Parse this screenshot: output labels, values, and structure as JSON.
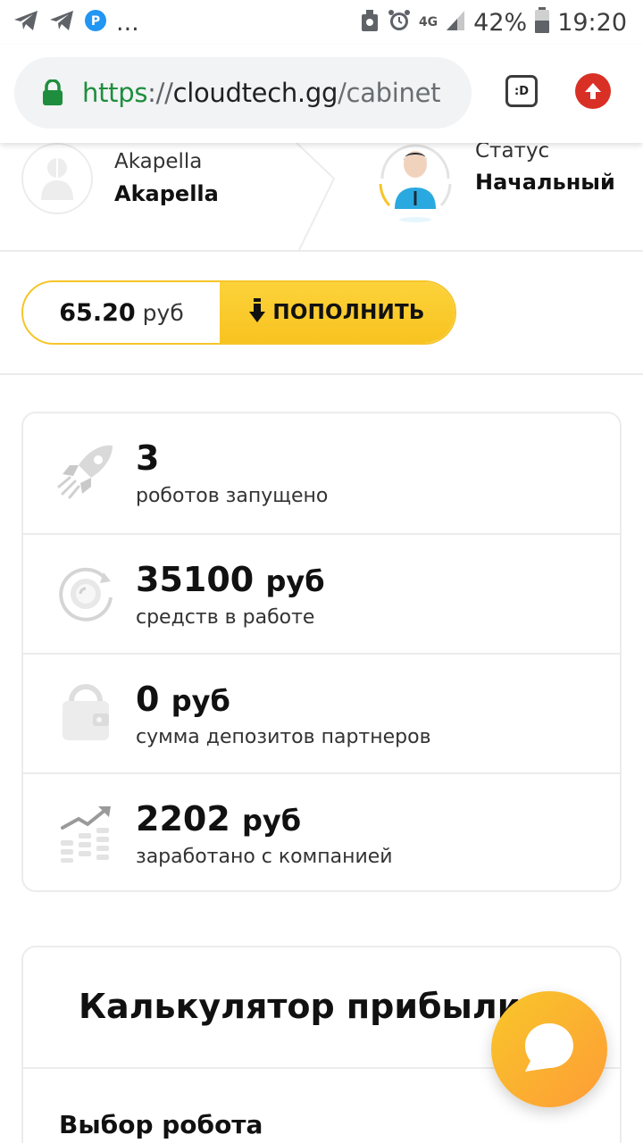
{
  "status_bar": {
    "more": "...",
    "network": "4G",
    "battery": "42%",
    "time": "19:20",
    "icons": [
      "telegram-icon",
      "telegram-icon",
      "parking-icon",
      "recycle-icon",
      "alarm-icon",
      "signal-icon",
      "battery-icon"
    ]
  },
  "browser": {
    "url": {
      "scheme": "https",
      "separator": "://",
      "host": "cloudtech.gg",
      "path": "/cabinet"
    },
    "tab_label": ":D",
    "colors": {
      "secure": "#1e8e3e",
      "upload": "#d93025"
    }
  },
  "profile": {
    "login": "Akapella",
    "name": "Akapella",
    "status_label": "Статус",
    "status_value": "Начальный"
  },
  "balance": {
    "amount": "65.20",
    "currency": "руб",
    "topup_label": "ПОПОЛНИТЬ",
    "accent": "#f8c320"
  },
  "stats": [
    {
      "value": "3",
      "unit": "",
      "label": "роботов запущено",
      "icon": "rocket-icon"
    },
    {
      "value": "35100",
      "unit": "руб",
      "label": "средств в работе",
      "icon": "coin-cycle-icon"
    },
    {
      "value": "0",
      "unit": "руб",
      "label": "сумма депозитов партнеров",
      "icon": "wallet-icon"
    },
    {
      "value": "2202",
      "unit": "руб",
      "label": "заработано с компанией",
      "icon": "growth-chart-icon"
    }
  ],
  "calculator": {
    "title": "Калькулятор прибыли",
    "robot_select_label": "Выбор робота"
  },
  "chat": {
    "icon": "chat-bubble-icon"
  }
}
